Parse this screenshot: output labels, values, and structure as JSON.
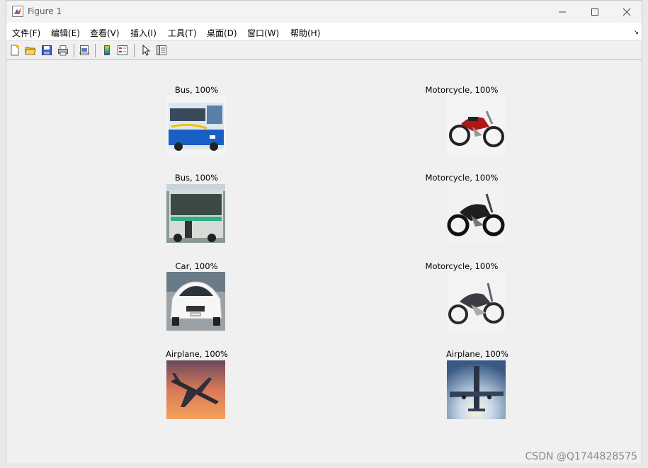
{
  "window": {
    "title": "Figure 1"
  },
  "menu": [
    "文件(F)",
    "编辑(E)",
    "查看(V)",
    "插入(I)",
    "工具(T)",
    "桌面(D)",
    "窗口(W)",
    "帮助(H)"
  ],
  "toolbar": {
    "buttons": [
      "new-figure-icon",
      "open-file-icon",
      "save-icon",
      "print-icon",
      "print-preview-icon",
      "colorbar-icon",
      "legend-icon",
      "edit-plot-icon",
      "property-inspector-icon"
    ]
  },
  "figures": [
    {
      "label": "Bus, 100%",
      "image": "bus-photo"
    },
    {
      "label": "Motorcycle, 100%",
      "image": "motorcycle-photo"
    },
    {
      "label": "Bus, 100%",
      "image": "bus-photo"
    },
    {
      "label": "Motorcycle, 100%",
      "image": "motorcycle-photo"
    },
    {
      "label": "Car, 100%",
      "image": "car-photo"
    },
    {
      "label": "Motorcycle, 100%",
      "image": "motorcycle-photo"
    },
    {
      "label": "Airplane, 100%",
      "image": "airplane-photo"
    },
    {
      "label": "Airplane, 100%",
      "image": "airplane-photo"
    }
  ],
  "watermark": "CSDN @Q1744828575"
}
